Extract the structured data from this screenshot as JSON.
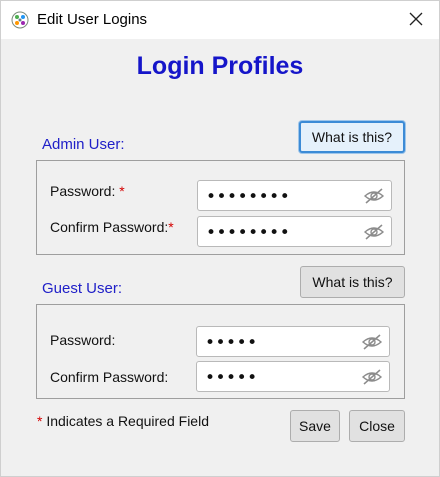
{
  "window": {
    "title": "Edit User Logins",
    "app_icon": "app-logo-icon",
    "close_icon": "close-icon"
  },
  "heading": "Login Profiles",
  "admin": {
    "label": "Admin User:",
    "help_label": "What is this?",
    "password_label": "Password:",
    "confirm_label": "Confirm Password:",
    "required_marker": "*",
    "password_value": "••••••••",
    "confirm_value": "••••••••"
  },
  "guest": {
    "label": "Guest User:",
    "help_label": "What is this?",
    "password_label": "Password:",
    "confirm_label": "Confirm Password:",
    "password_value": "•••••",
    "confirm_value": "•••••"
  },
  "footer": {
    "required_marker": "*",
    "required_note": " Indicates a Required Field",
    "save_label": "Save",
    "close_label": "Close"
  },
  "colors": {
    "heading": "#1515c9",
    "section_label": "#2020c8",
    "required": "#d40000",
    "focus": "#3c8bd6"
  },
  "icons": {
    "visibility_toggle": "eye-slash-icon"
  }
}
